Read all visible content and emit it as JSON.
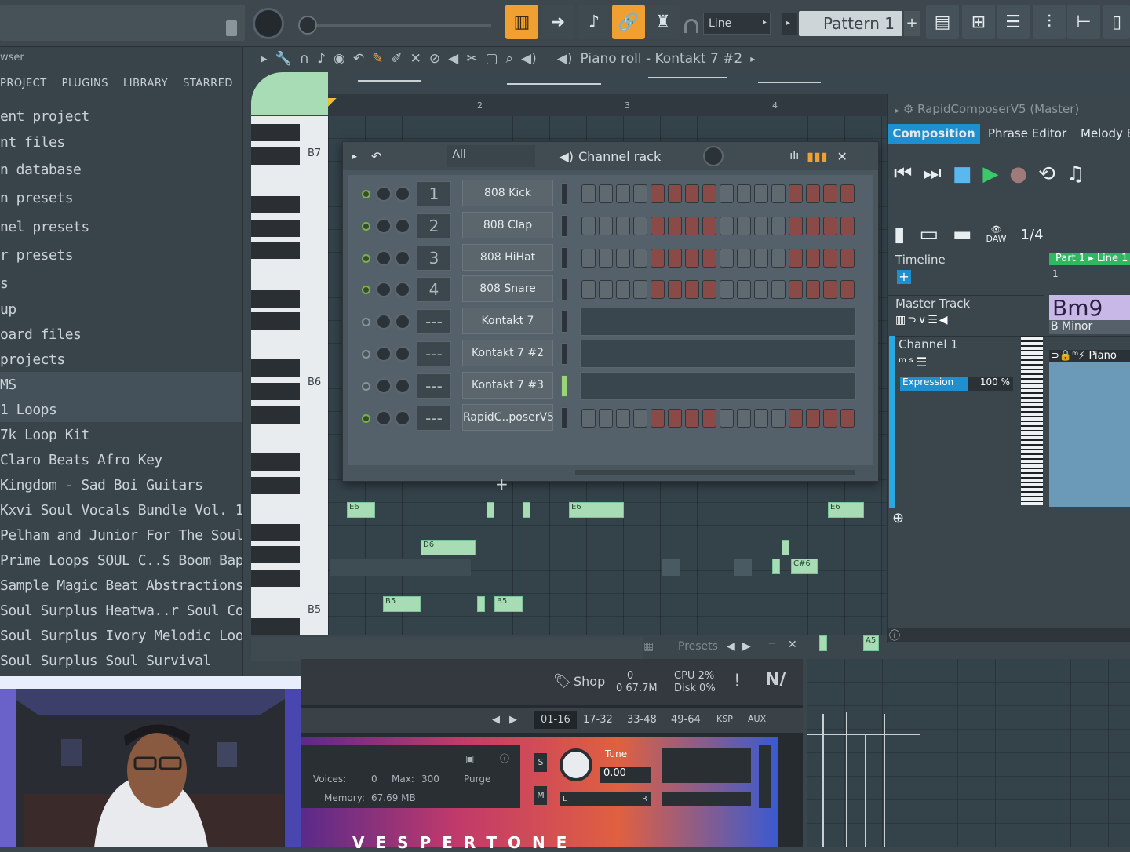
{
  "toolbar": {
    "mode_label": "Line",
    "pattern_label": "Pattern 1"
  },
  "browser": {
    "header": "wser",
    "tabs": [
      "PROJECT",
      "PLUGINS",
      "LIBRARY",
      "STARRED"
    ],
    "items": [
      "ent project",
      "nt files",
      "n database",
      "n presets",
      "nel presets",
      "r presets",
      "s",
      "up",
      "oard files",
      "projects",
      "MS",
      "1 Loops",
      "7k Loop Kit",
      "Claro Beats Afro Key",
      "Kingdom - Sad Boi Guitars",
      "Kxvi Soul Vocals Bundle Vol. 1",
      "Pelham and Junior For The Soul",
      "Prime Loops SOUL C..S Boom Bap Edition",
      "Sample Magic Beat Abstractions",
      "Soul Surplus Heatwa..r Soul Compositions",
      "Soul Surplus Ivory Melodic Loops",
      "Soul Surplus Soul Survival"
    ]
  },
  "piano_roll": {
    "title": "Piano roll - Kontakt 7 #2",
    "bar_numbers": [
      "2",
      "3",
      "4"
    ],
    "key_labels": [
      "B7",
      "B6",
      "B5"
    ],
    "notes": [
      "E6",
      "E6",
      "E6",
      "D6",
      "C#6",
      "B5",
      "B5",
      "A5"
    ]
  },
  "channel_rack": {
    "filter": "All",
    "title": "Channel rack",
    "add_label": "+",
    "channels": [
      {
        "num": "1",
        "name": "808 Kick",
        "active": true
      },
      {
        "num": "2",
        "name": "808 Clap",
        "active": true
      },
      {
        "num": "3",
        "name": "808 HiHat",
        "active": true
      },
      {
        "num": "4",
        "name": "808 Snare",
        "active": true
      },
      {
        "num": "---",
        "name": "Kontakt 7",
        "active": false
      },
      {
        "num": "---",
        "name": "Kontakt 7 #2",
        "active": false
      },
      {
        "num": "---",
        "name": "Kontakt 7 #3",
        "active": false
      },
      {
        "num": "---",
        "name": "RapidC..poserV5",
        "active": true
      }
    ]
  },
  "rapid_composer": {
    "title": "RapidComposerV5",
    "title_suffix": "(Master)",
    "tabs": [
      "Composition",
      "Phrase Editor",
      "Melody E"
    ],
    "grid_label": "1/4",
    "daw_label": "DAW",
    "timeline_label": "Timeline",
    "part_label": "Part 1 ▸ Line 1",
    "bar_one": "1",
    "master_track_label": "Master Track",
    "chord_name": "Bm9",
    "chord_key": "B Minor",
    "channel_label": "Channel 1",
    "expression_label": "Expression",
    "expression_value": "100 %",
    "instrument_label": "Piano"
  },
  "kontakt": {
    "presets_label": "Presets",
    "shop_label": "Shop",
    "midi_in": "0",
    "mem_total": "0 67.7M",
    "cpu": "CPU 2%",
    "disk": "Disk 0%",
    "ranges": [
      "01-16",
      "17-32",
      "33-48",
      "49-64",
      "KSP",
      "AUX"
    ],
    "voices_label": "Voices:",
    "voices_value": "0",
    "max_label": "Max:",
    "max_value": "300",
    "purge_label": "Purge",
    "memory_label": "Memory:",
    "memory_value": "67.69 MB",
    "tune_label": "Tune",
    "tune_value": "0.00",
    "solo_label": "S",
    "mute_label": "M",
    "left_label": "L",
    "right_label": "R",
    "brand": "VESPERTONE"
  },
  "colors": {
    "accent_orange": "#f0a030",
    "note_green": "#a8dcb5",
    "rc_blue": "#2aa8e0",
    "rc_green": "#3ac86a"
  }
}
